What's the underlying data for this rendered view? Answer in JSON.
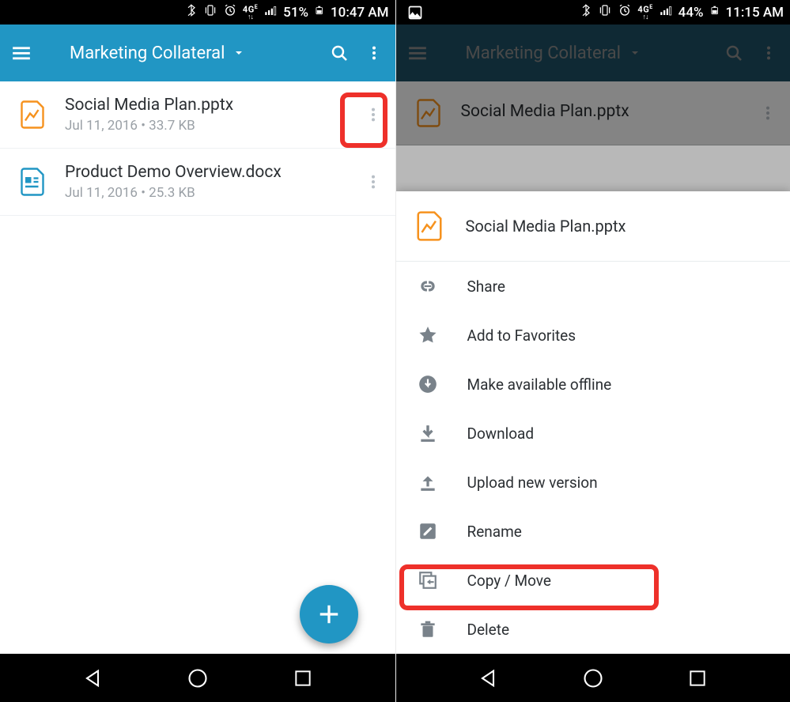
{
  "screen1": {
    "status": {
      "battery": "51%",
      "time": "10:47 AM"
    },
    "appbar": {
      "title": "Marketing Collateral"
    },
    "files": [
      {
        "name": "Social Media Plan.pptx",
        "meta": "Jul 11, 2016  • 33.7 KB",
        "icon": "pptx"
      },
      {
        "name": "Product Demo Overview.docx",
        "meta": "Jul 11, 2016  • 25.3 KB",
        "icon": "docx"
      }
    ]
  },
  "screen2": {
    "status": {
      "battery": "44%",
      "time": "11:15 AM"
    },
    "appbar": {
      "title": "Marketing Collateral"
    },
    "bgfile": {
      "name": "Social Media Plan.pptx"
    },
    "sheet": {
      "title": "Social Media Plan.pptx",
      "items": [
        {
          "label": "Share",
          "icon": "link"
        },
        {
          "label": "Add to Favorites",
          "icon": "star"
        },
        {
          "label": "Make available offline",
          "icon": "offline"
        },
        {
          "label": "Download",
          "icon": "download"
        },
        {
          "label": "Upload new version",
          "icon": "upload"
        },
        {
          "label": "Rename",
          "icon": "rename"
        },
        {
          "label": "Copy / Move",
          "icon": "copymove"
        },
        {
          "label": "Delete",
          "icon": "delete"
        }
      ]
    }
  }
}
